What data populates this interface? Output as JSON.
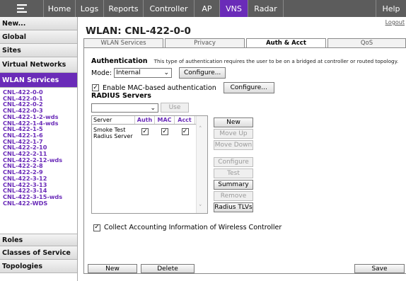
{
  "topnav": {
    "tabs": [
      {
        "label": "Home",
        "active": false
      },
      {
        "label": "Logs",
        "active": false
      },
      {
        "label": "Reports",
        "active": false
      },
      {
        "label": "Controller",
        "active": false
      },
      {
        "label": "AP",
        "active": false
      },
      {
        "label": "VNS",
        "active": true
      },
      {
        "label": "Radar",
        "active": false
      }
    ],
    "help": "Help",
    "logout": "Logout",
    "accent": "#6a2bb8"
  },
  "sidebar": {
    "top_sections": [
      "New...",
      "Global",
      "Sites",
      "Virtual Networks"
    ],
    "active_section": "WLAN Services",
    "items": [
      "CNL-422-0-0",
      "CNL-422-0-1",
      "CNL-422-0-2",
      "CNL-422-0-3",
      "CNL-422-1-2-wds",
      "CNL-422-1-4-wds",
      "CNL-422-1-5",
      "CNL-422-1-6",
      "CNL-422-1-7",
      "CNL-422-2-10",
      "CNL-422-2-11",
      "CNL-422-2-12-wds",
      "CNL-422-2-8",
      "CNL-422-2-9",
      "CNL-422-3-12",
      "CNL-422-3-13",
      "CNL-422-3-14",
      "CNL-422-3-15-wds",
      "CNL-422-WDS"
    ],
    "bottom_sections": [
      "Roles",
      "Classes of Service",
      "Topologies"
    ]
  },
  "main": {
    "title": "WLAN: CNL-422-0-0",
    "tabs": [
      {
        "label": "WLAN Services",
        "active": false
      },
      {
        "label": "Privacy",
        "active": false
      },
      {
        "label": "Auth & Acct",
        "active": true
      },
      {
        "label": "QoS",
        "active": false
      }
    ]
  },
  "auth": {
    "heading": "Authentication",
    "description": "This type of authentication requires the user to be on a bridged at controller or routed topology.",
    "mode_label": "Mode:",
    "mode_value": "Internal",
    "configure_label": "Configure...",
    "mac_label": "Enable MAC-based authentication",
    "mac_checked": true,
    "mac_configure_label": "Configure..."
  },
  "radius": {
    "heading": "RADIUS Servers",
    "use_label": "Use",
    "columns": [
      "Server",
      "Auth",
      "MAC",
      "Acct"
    ],
    "rows": [
      {
        "server": "Smoke Test Radius Server",
        "auth": true,
        "mac": true,
        "acct": true
      }
    ],
    "buttons": [
      {
        "label": "New",
        "enabled": true
      },
      {
        "label": "Move Up",
        "enabled": false
      },
      {
        "label": "Move Down",
        "enabled": false
      },
      {
        "label": "Configure",
        "enabled": false
      },
      {
        "label": "Test",
        "enabled": false
      },
      {
        "label": "Summary",
        "enabled": true
      },
      {
        "label": "Remove",
        "enabled": false
      },
      {
        "label": "Radius TLVs",
        "enabled": true
      }
    ]
  },
  "accounting": {
    "label": "Collect Accounting Information of Wireless Controller",
    "checked": true
  },
  "footer": {
    "new_label": "New",
    "delete_label": "Delete",
    "save_label": "Save"
  }
}
